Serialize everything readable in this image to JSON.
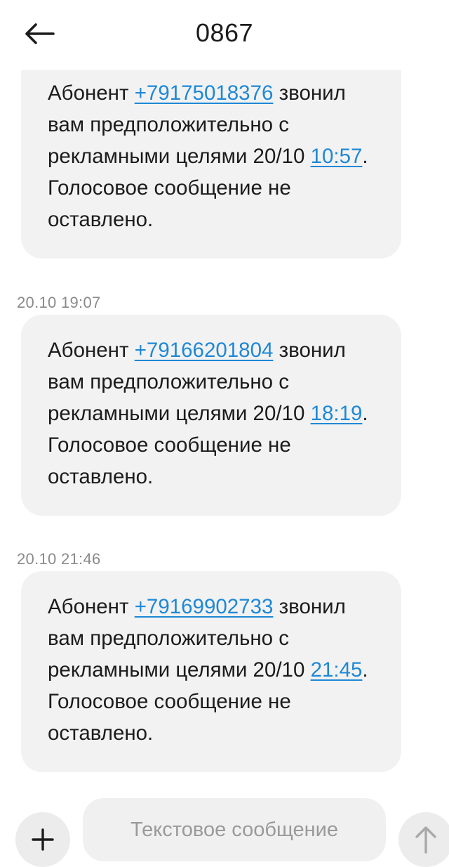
{
  "header": {
    "title": "0867",
    "back_icon": "arrow-left-icon"
  },
  "messages": [
    {
      "prefix": "Абонент ",
      "phone": "+79175018376",
      "mid": " звонил вам предположительно с рекламными целями 20/10 ",
      "time": "10:57",
      "suffix": ". Голосовое сообщение не оставлено."
    },
    {
      "timestamp": "20.10 19:07",
      "prefix": "Абонент ",
      "phone": "+79166201804",
      "mid": " звонил вам предположительно с рекламными целями 20/10 ",
      "time": "18:19",
      "suffix": ". Голосовое сообщение не оставлено."
    },
    {
      "timestamp": "20.10 21:46",
      "prefix": "Абонент ",
      "phone": "+79169902733",
      "mid": " звонил вам предположительно с рекламными целями 20/10 ",
      "time": "21:45",
      "suffix": ". Голосовое сообщение не оставлено."
    }
  ],
  "composer": {
    "placeholder": "Текстовое сообщение",
    "add_icon": "plus-icon",
    "send_icon": "arrow-up-icon"
  },
  "colors": {
    "link": "#1e88d6",
    "bubble": "#f2f2f2",
    "timestamp": "#8a8a8a"
  }
}
